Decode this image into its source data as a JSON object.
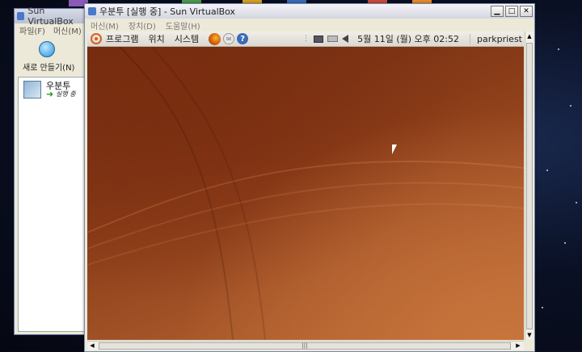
{
  "manager": {
    "title": "Sun VirtualBox",
    "menu": [
      "파일(F)",
      "머신(M)"
    ],
    "new_label": "새로 만들기(N)",
    "vm": {
      "name": "우분투",
      "state": "실행 중"
    }
  },
  "vm_window": {
    "title": "우분투 [실행 중] - Sun VirtualBox",
    "menu": [
      "머신(M)",
      "장치(D)",
      "도움말(H)"
    ],
    "buttons": {
      "minimize": "▁",
      "maximize": "□",
      "close": "✕"
    }
  },
  "guest_panel": {
    "menus": [
      "프로그램",
      "위치",
      "시스템"
    ],
    "clock": "5월 11일 (월) 오후 02:52",
    "user": "parkpriest"
  },
  "colors": {
    "ubuntu_accent": "#d8601a",
    "desktop_brown": "#8a3c18"
  },
  "icons": [
    "ubuntu-logo-icon",
    "firefox-icon",
    "mail-icon",
    "help-icon",
    "network-icon",
    "printer-icon",
    "volume-icon"
  ]
}
